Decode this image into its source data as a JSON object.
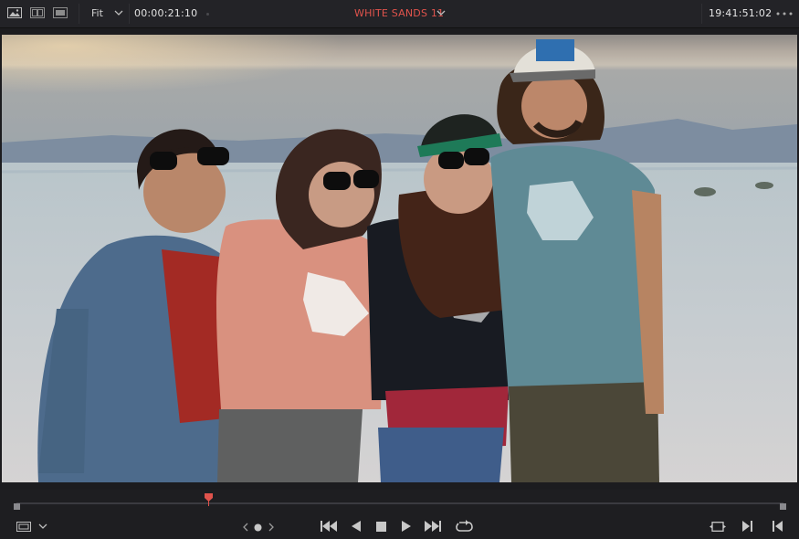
{
  "topbar": {
    "zoom_label": "Fit",
    "source_timecode": "00:00:21:10",
    "clip_name": "WHITE SANDS 11",
    "record_timecode": "19:41:51:02"
  },
  "colors": {
    "clip_name": "#e0534c",
    "playhead": "#e0534c",
    "background": "#1c1c1f",
    "topbar": "#232327"
  },
  "icons": [
    "image-view-icon",
    "dual-view-icon",
    "filmstrip-view-icon",
    "chevron-down-icon",
    "more-options-icon",
    "viewer-options-icon",
    "nav-previous-icon",
    "nav-dot-icon",
    "nav-next-icon",
    "jump-to-start-icon",
    "play-reverse-icon",
    "stop-icon",
    "play-icon",
    "jump-to-end-icon",
    "loop-icon",
    "match-frame-icon",
    "go-to-next-icon",
    "go-to-previous-icon"
  ],
  "scrubber": {
    "playhead_position_fraction": 0.25
  },
  "viewer": {
    "content": "video frame"
  }
}
